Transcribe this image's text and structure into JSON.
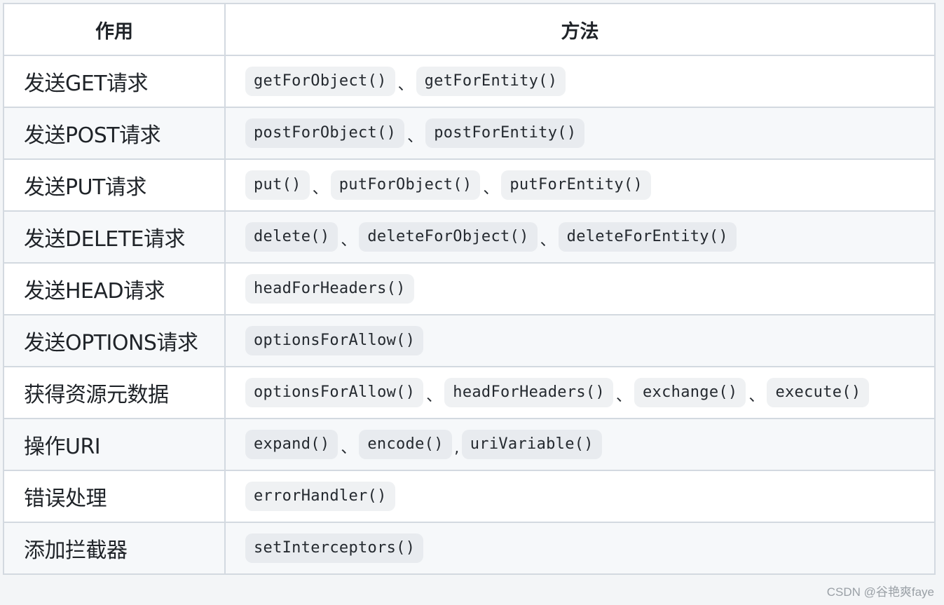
{
  "table": {
    "headers": [
      "作用",
      "方法"
    ],
    "rows": [
      {
        "purpose": "发送GET请求",
        "methods": [
          "getForObject()",
          "getForEntity()"
        ],
        "separators": [
          "、"
        ]
      },
      {
        "purpose": "发送POST请求",
        "methods": [
          "postForObject()",
          "postForEntity()"
        ],
        "separators": [
          "、"
        ]
      },
      {
        "purpose": "发送PUT请求",
        "methods": [
          "put()",
          "putForObject()",
          "putForEntity()"
        ],
        "separators": [
          "、",
          "、"
        ]
      },
      {
        "purpose": "发送DELETE请求",
        "methods": [
          "delete()",
          "deleteForObject()",
          "deleteForEntity()"
        ],
        "separators": [
          "、",
          "、"
        ]
      },
      {
        "purpose": "发送HEAD请求",
        "methods": [
          "headForHeaders()"
        ],
        "separators": []
      },
      {
        "purpose": "发送OPTIONS请求",
        "methods": [
          "optionsForAllow()"
        ],
        "separators": []
      },
      {
        "purpose": "获得资源元数据",
        "methods": [
          "optionsForAllow()",
          "headForHeaders()",
          "exchange()",
          "execute()"
        ],
        "separators": [
          "、",
          "、",
          "、"
        ]
      },
      {
        "purpose": "操作URI",
        "methods": [
          "expand()",
          "encode()",
          "uriVariable()"
        ],
        "separators": [
          "、",
          ","
        ]
      },
      {
        "purpose": "错误处理",
        "methods": [
          "errorHandler()"
        ],
        "separators": []
      },
      {
        "purpose": "添加拦截器",
        "methods": [
          "setInterceptors()"
        ],
        "separators": []
      }
    ]
  },
  "watermark": "CSDN @谷艳爽faye"
}
